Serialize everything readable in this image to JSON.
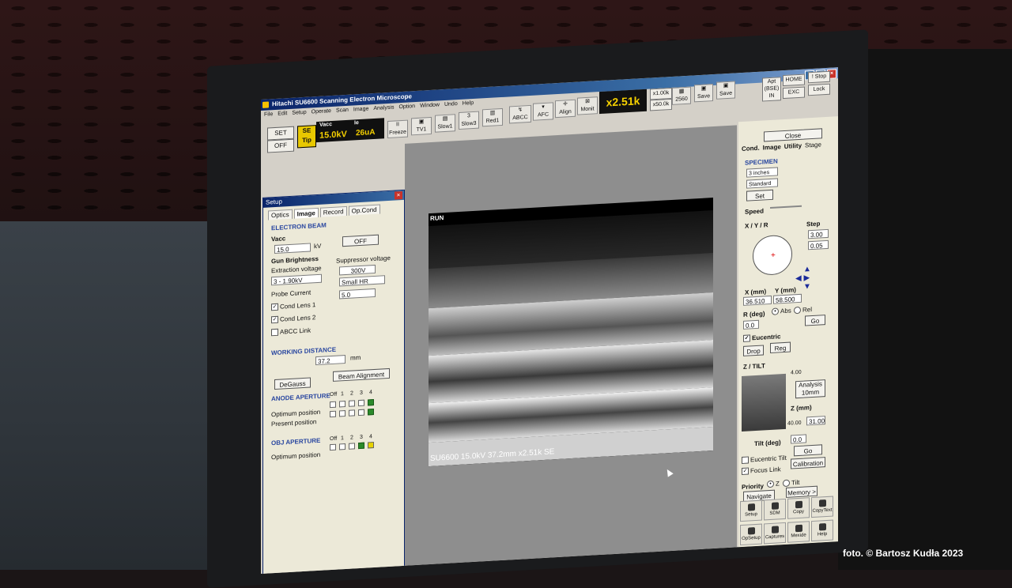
{
  "window": {
    "title": "Hitachi SU6600 Scanning Electron Microscope"
  },
  "menu": [
    "File",
    "Edit",
    "Setup",
    "Operate",
    "Scan",
    "Image",
    "Analysis",
    "Option",
    "Window",
    "Undo",
    "Help"
  ],
  "toolbar": {
    "set": "SET",
    "off": "OFF",
    "se_tip_1": "SE",
    "se_tip_2": "Tip",
    "vacc_label": "Vacc",
    "ie_label": "Ie",
    "vacc_value": "15.0kV",
    "ie_value": "26uA",
    "freeze": "Freeze",
    "tv1": "TV1",
    "slow1": "Slow1",
    "slow3": "Slow3",
    "red1": "Red1",
    "abcc": "ABCC",
    "afc": "AFC",
    "align": "Align",
    "monit": "Monit",
    "magnification": "x2.51k",
    "x1k": "x1.00k",
    "x50k": "x50.0k",
    "px2560": "2560",
    "save1": "Save",
    "save2": "Save",
    "apt": "Apt (BSE) IN",
    "home": "HOME",
    "exc": "EXC",
    "stop": "! Stop",
    "lock": "Lock"
  },
  "setup_dialog": {
    "title": "Setup",
    "tabs": [
      "Optics",
      "Image",
      "Record",
      "Op.Cond"
    ],
    "electron_beam": "ELECTRON BEAM",
    "vacc_label": "Vacc",
    "vacc_value": "15.0",
    "vacc_unit": "kV",
    "off_button": "OFF",
    "gun_brightness": "Gun Brightness",
    "extraction_voltage": "Extraction voltage",
    "extraction_value": "3 - 1.90kV",
    "suppressor_voltage": "Suppressor voltage",
    "suppressor_value": "300V",
    "probe_current": "Probe Current",
    "probe_mode": "Small HR",
    "probe_value": "5.0",
    "cond_lens_1": "Cond Lens 1",
    "cond_lens_2": "Cond Lens 2",
    "abcc_link": "ABCC Link",
    "working_distance": "WORKING DISTANCE",
    "wd_value": "37.2",
    "wd_unit": "mm",
    "degauss": "DeGauss",
    "beam_alignment": "Beam Alignment",
    "anode_aperture": "ANODE APERTURE",
    "aperture_cols": [
      "Off",
      "1",
      "2",
      "3",
      "4"
    ],
    "optimum_position": "Optimum position",
    "present_position": "Present position",
    "obj_aperture": "OBJ APERTURE",
    "obj_optimum_position": "Optimum position"
  },
  "image": {
    "run_label": "RUN",
    "info_bar": "SU6600 15.0kV 37.2mm x2.51k SE"
  },
  "right_panel": {
    "close": "Close",
    "tabs": [
      "Cond.",
      "Image",
      "Utility",
      "Stage"
    ],
    "specimen": "SPECIMEN",
    "size": "3 inches",
    "holder": "Standard",
    "set": "Set",
    "speed": "Speed",
    "xyr": "X / Y / R",
    "step": "Step",
    "step_x": "3.00",
    "step_y": "0.05",
    "x_label": "X (mm)",
    "y_label": "Y (mm)",
    "x_value": "36.510",
    "y_value": "58.500",
    "r_label": "R (deg)",
    "r_value": "0.0",
    "abs": "Abs",
    "rel": "Rel",
    "go": "Go",
    "eucentric": "Eucentric",
    "drop": "Drop",
    "reg": "Reg",
    "ztilt": "Z / TILT",
    "z_top": "4.00",
    "analysis_1": "Analysis",
    "analysis_2": "10mm",
    "z_mm": "Z (mm)",
    "z_value": "31.00",
    "z_low": "40.00",
    "tilt_label": "Tilt (deg)",
    "tilt_value": "0.0",
    "go2": "Go",
    "eucentric_tilt": "Eucentric Tilt",
    "focus_link": "Focus Link",
    "calibration": "Calibration",
    "priority": "Priority",
    "prio_z": "Z",
    "prio_tilt": "Tilt",
    "navigate": "Navigate >",
    "memory": "Memory >",
    "icons": [
      "Setup",
      "SDM",
      "Copy",
      "CopyText",
      "OpSetup",
      "Captures",
      "Mexide",
      "Help"
    ]
  },
  "credit": "foto. © Bartosz Kudła 2023"
}
